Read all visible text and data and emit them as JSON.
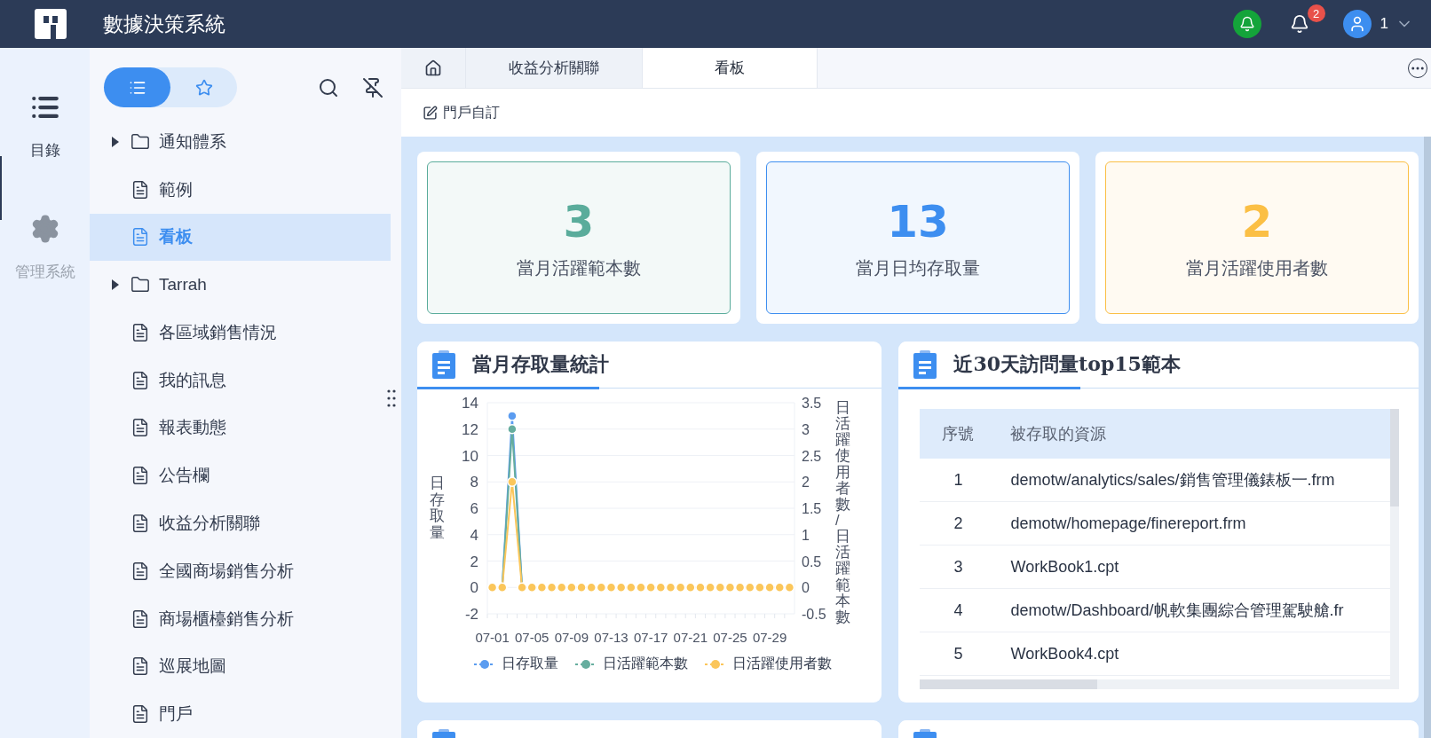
{
  "app": {
    "title": "數據決策系統"
  },
  "header": {
    "notification_badge": "2",
    "user": "1"
  },
  "rail": [
    {
      "label": "目錄",
      "kind": "list",
      "selected": true
    },
    {
      "label": "管理系統",
      "kind": "gear",
      "selected": false
    }
  ],
  "nav": {
    "toggles": [
      {
        "kind": "list",
        "selected": true
      },
      {
        "kind": "star",
        "selected": false
      }
    ],
    "items": [
      {
        "label": "通知體系",
        "kind": "folder",
        "expanded": false,
        "selected": false
      },
      {
        "label": "範例",
        "kind": "file",
        "selected": false
      },
      {
        "label": "看板",
        "kind": "file",
        "selected": true
      },
      {
        "label": "Tarrah",
        "kind": "folder",
        "expanded": false,
        "selected": false
      },
      {
        "label": "各區域銷售情況",
        "kind": "file",
        "selected": false
      },
      {
        "label": "我的訊息",
        "kind": "file",
        "selected": false
      },
      {
        "label": "報表動態",
        "kind": "file",
        "selected": false
      },
      {
        "label": "公告欄",
        "kind": "file",
        "selected": false
      },
      {
        "label": "收益分析關聯",
        "kind": "file",
        "selected": false
      },
      {
        "label": "全國商場銷售分析",
        "kind": "file",
        "selected": false
      },
      {
        "label": "商場櫃檯銷售分析",
        "kind": "file",
        "selected": false
      },
      {
        "label": "巡展地圖",
        "kind": "file",
        "selected": false
      },
      {
        "label": "門戶",
        "kind": "file",
        "selected": false
      }
    ]
  },
  "tabs": [
    {
      "kind": "home",
      "selected": false
    },
    {
      "kind": "text",
      "label": "收益分析關聯",
      "selected": false
    },
    {
      "kind": "text",
      "label": "看板",
      "selected": true
    }
  ],
  "toolbar": {
    "action": "門戶自訂"
  },
  "kpis": [
    {
      "value": "3",
      "label": "當月活躍範本數",
      "color": "#5aac9b"
    },
    {
      "value": "13",
      "label": "當月日均存取量",
      "color": "#3d8ef0"
    },
    {
      "value": "2",
      "label": "當月活躍使用者數",
      "color": "#fbbf45"
    }
  ],
  "chart_panel": {
    "title": "當月存取量統計",
    "chart_data": {
      "type": "line",
      "ylabel": "日存取量",
      "y2label": "日活躍使用者數/日活躍範本數",
      "categories": [
        "07-01",
        null,
        null,
        null,
        "07-05",
        null,
        null,
        null,
        "07-09",
        null,
        null,
        null,
        "07-13",
        null,
        null,
        null,
        "07-17",
        null,
        null,
        null,
        "07-21",
        null,
        null,
        null,
        "07-25",
        null,
        null,
        null,
        "07-29",
        null,
        null
      ],
      "ylim": [
        -2,
        14
      ],
      "yticks": [
        -2,
        0,
        2,
        4,
        6,
        8,
        10,
        12,
        14
      ],
      "grid": true,
      "y2lim": [
        -0.5,
        3.5
      ],
      "y2ticks": [
        -0.5,
        0,
        0.5,
        1,
        1.5,
        2,
        2.5,
        3,
        3.5
      ],
      "series": [
        {
          "name": "日存取量",
          "color": "#5b9cf0",
          "marker": "circle",
          "values": [
            null,
            0,
            13,
            0,
            null,
            null,
            null,
            null,
            null,
            null,
            null,
            null,
            null,
            null,
            null,
            null,
            null,
            null,
            null,
            null,
            null,
            null,
            null,
            null,
            null,
            null,
            null,
            null,
            null,
            null,
            null
          ]
        },
        {
          "name": "日活躍範本數",
          "color": "#66ad9e",
          "marker": "circle",
          "axis": "y2",
          "values": [
            null,
            0,
            3,
            0,
            null,
            null,
            null,
            null,
            null,
            null,
            null,
            null,
            null,
            null,
            null,
            null,
            null,
            null,
            null,
            null,
            null,
            null,
            null,
            null,
            null,
            null,
            null,
            null,
            null,
            null,
            null
          ]
        },
        {
          "name": "日活躍使用者數",
          "color": "#fbc65a",
          "marker": "circle",
          "axis": "y2",
          "values": [
            0,
            0,
            2,
            0,
            0,
            0,
            0,
            0,
            0,
            0,
            0,
            0,
            0,
            0,
            0,
            0,
            0,
            0,
            0,
            0,
            0,
            0,
            0,
            0,
            0,
            0,
            0,
            0,
            0,
            0,
            0
          ]
        }
      ]
    }
  },
  "table_panel": {
    "title": "近30天訪問量top15範本",
    "columns": [
      "序號",
      "被存取的資源"
    ],
    "rows": [
      [
        "1",
        "demotw/analytics/sales/銷售管理儀錶板一.frm"
      ],
      [
        "2",
        "demotw/homepage/finereport.frm"
      ],
      [
        "3",
        "WorkBook1.cpt"
      ],
      [
        "4",
        "demotw/Dashboard/帆軟集團綜合管理駕駛艙.fr"
      ],
      [
        "5",
        "WorkBook4.cpt"
      ]
    ]
  },
  "lower_panels": [
    {
      "kind": "card"
    },
    {
      "kind": "card"
    }
  ]
}
